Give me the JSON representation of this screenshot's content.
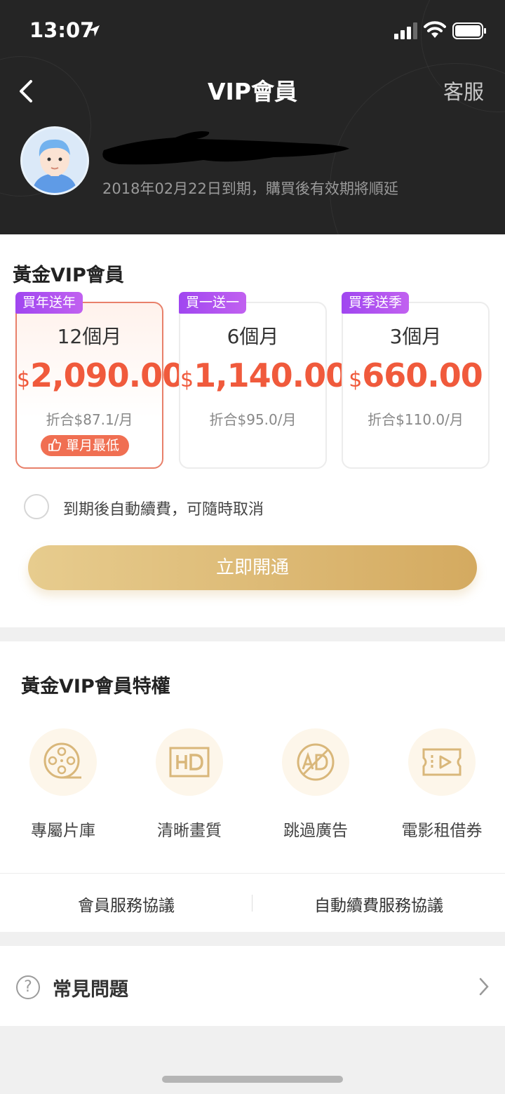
{
  "status_bar": {
    "time": "13:07"
  },
  "nav": {
    "title": "VIP會員",
    "service": "客服"
  },
  "user": {
    "expiry": "2018年02月22日到期，購買後有效期將順延"
  },
  "plans": {
    "title": "黃金VIP會員",
    "cards": [
      {
        "badge": "買年送年",
        "months": "12個月",
        "currency": "$",
        "price": "2,090.00",
        "monthly": "折合$87.1/月",
        "tag": "單月最低",
        "selected": true
      },
      {
        "badge": "買一送一",
        "months": "6個月",
        "currency": "$",
        "price": "1,140.00",
        "monthly": "折合$95.0/月",
        "selected": false
      },
      {
        "badge": "買季送季",
        "months": "3個月",
        "currency": "$",
        "price": "660.00",
        "monthly": "折合$110.0/月",
        "selected": false
      }
    ],
    "auto_renew_label": "到期後自動續費，可隨時取消",
    "activate_label": "立即開通"
  },
  "privileges": {
    "title": "黃金VIP會員特權",
    "items": [
      {
        "label": "專屬片庫",
        "icon": "film-reel-icon"
      },
      {
        "label": "清晰畫質",
        "icon": "hd-icon"
      },
      {
        "label": "跳過廣告",
        "icon": "no-ads-icon"
      },
      {
        "label": "電影租借券",
        "icon": "ticket-play-icon"
      }
    ]
  },
  "agreements": {
    "member": "會員服務協議",
    "auto_renew": "自動續費服務協議"
  },
  "faq": {
    "label": "常見問題",
    "icon_glyph": "?"
  },
  "colors": {
    "gold": "#d4aa60",
    "price_red": "#f05a3c",
    "badge_purple": "#a046f0",
    "header_bg": "#252525"
  }
}
